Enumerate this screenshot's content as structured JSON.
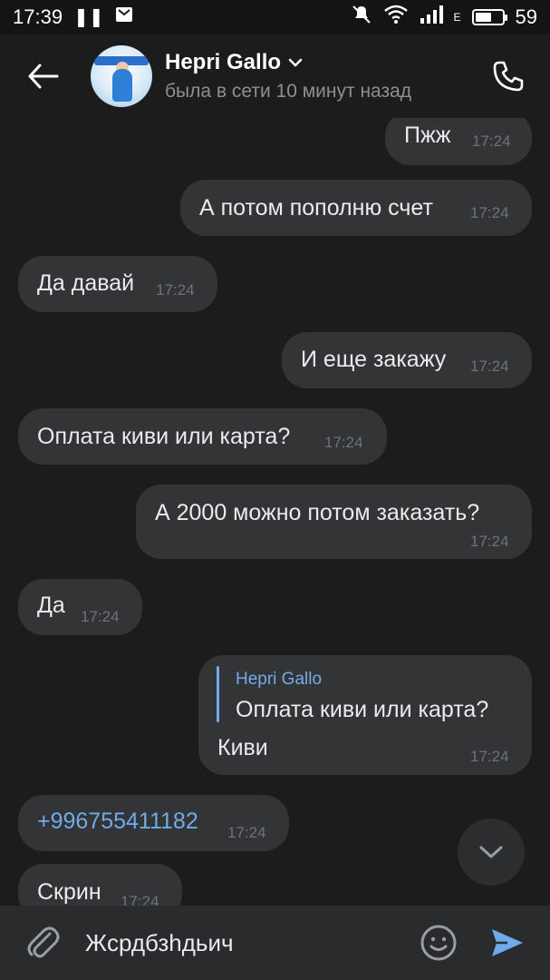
{
  "status_bar": {
    "time": "17:39",
    "battery": "59",
    "network": "E"
  },
  "header": {
    "contact_name": "Hepri Gallo",
    "last_seen": "была в сети 10 минут назад"
  },
  "messages": [
    {
      "direction": "out",
      "text": "Пжж",
      "time": "17:24"
    },
    {
      "direction": "out",
      "text": "А потом пополню счет",
      "time": "17:24"
    },
    {
      "direction": "in",
      "text": "Да давай",
      "time": "17:24"
    },
    {
      "direction": "out",
      "text": "И еще закажу",
      "time": "17:24"
    },
    {
      "direction": "in",
      "text": "Оплата киви или карта?",
      "time": "17:24"
    },
    {
      "direction": "out",
      "text": "А 2000 можно потом заказать?",
      "time": "17:24"
    },
    {
      "direction": "in",
      "text": "Да",
      "time": "17:24"
    },
    {
      "direction": "out",
      "reply_name": "Hepri Gallo",
      "reply_text": "Оплата киви или карта?",
      "text": "Киви",
      "time": "17:24"
    },
    {
      "direction": "in",
      "text": "+996755411182",
      "time": "17:24"
    },
    {
      "direction": "in",
      "text": "Скрин",
      "time": "17:24"
    }
  ],
  "composer": {
    "value": "Жсрдбзһдьич"
  },
  "colors": {
    "accent": "#71aaeb",
    "bubble": "#333436",
    "background": "#1c1c1d"
  }
}
